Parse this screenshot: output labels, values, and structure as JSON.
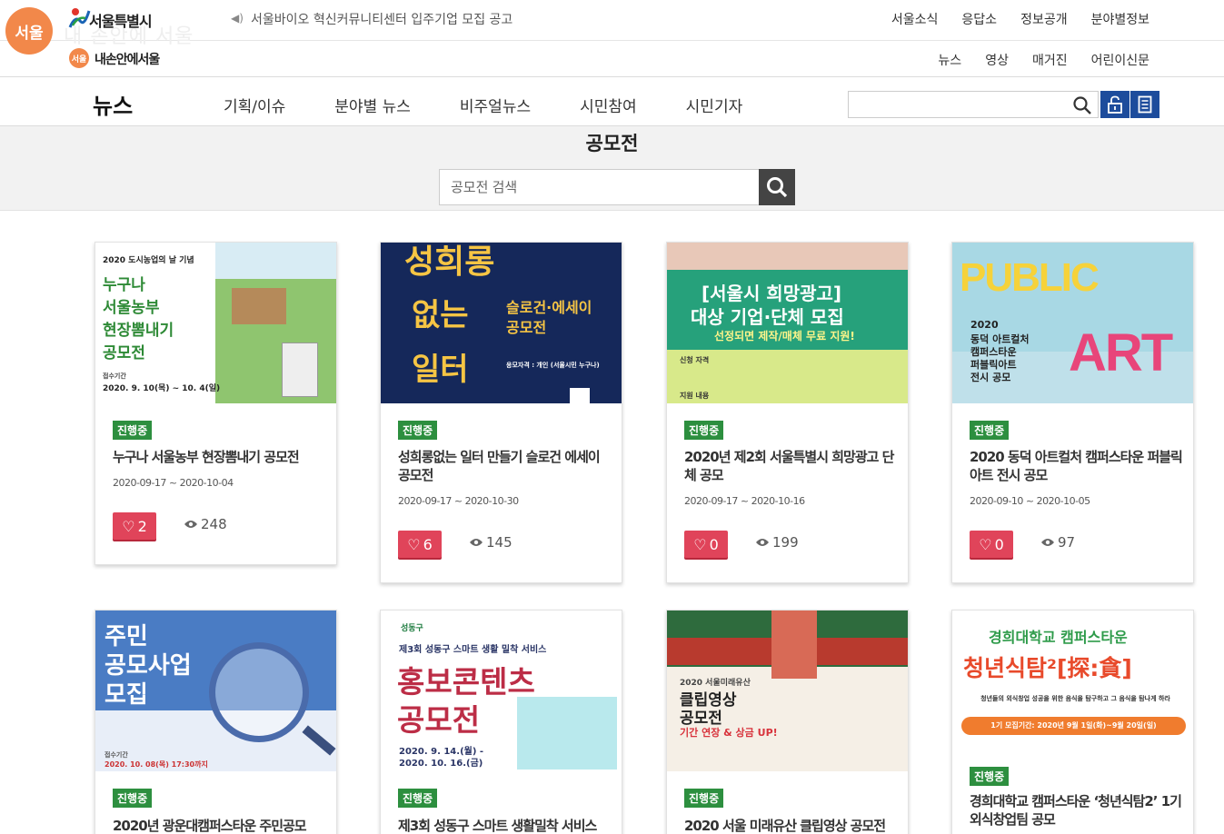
{
  "header": {
    "logo_circle_text": "서울",
    "city_name": "서울특별시",
    "logo_ghost": "내 손안에 서울",
    "notice": "서울바이오 혁신커뮤니티센터 입주기업 모집 공고",
    "util_nav": [
      "서울소식",
      "응답소",
      "정보공개",
      "분야별정보"
    ],
    "sub_logo_mark": "서울",
    "sub_logo": "내손안에서울",
    "sub_nav": [
      "뉴스",
      "영상",
      "매거진",
      "어린이신문"
    ]
  },
  "main_nav": {
    "title": "뉴스",
    "items": [
      "기획/이슈",
      "분야별 뉴스",
      "비주얼뉴스",
      "시민참여",
      "시민기자"
    ],
    "search_placeholder": ""
  },
  "contest": {
    "title": "공모전",
    "search_placeholder": "공모전 검색"
  },
  "cards": [
    {
      "badge": "진행중",
      "title": "누구나 서울농부 현장뽐내기 공모전",
      "date": "2020-09-17 ~ 2020-10-04",
      "likes": "2",
      "views": "248",
      "thumb": {
        "line1": "2020 도시농업의 날 기념",
        "line2": "누구나",
        "line3": "서울농부",
        "line4": "현장뽐내기",
        "line5": "공모전",
        "line6": "접수기간",
        "line7": "2020. 9. 10(목) ~ 10. 4(일)"
      }
    },
    {
      "badge": "진행중",
      "title": "성희롱없는 일터 만들기 슬로건 에세이 공모전",
      "date": "2020-09-17 ~ 2020-10-30",
      "likes": "6",
      "views": "145",
      "thumb": {
        "line1": "성희롱",
        "line2": "없는",
        "line3": "일터",
        "line4": "슬로건·에세이",
        "line5": "공모전",
        "line6": "응모자격 : 개인 (서울시민 누구나)"
      }
    },
    {
      "badge": "진행중",
      "title": "2020년 제2회 서울특별시 희망광고 단체 공모",
      "date": "2020-09-17 ~ 2020-10-16",
      "likes": "0",
      "views": "199",
      "thumb": {
        "line1": "[서울시 희망광고]",
        "line2": "대상 기업·단체 모집",
        "line3": "선정되면 제작/매체 무료 지원!",
        "line4": "신청 자격",
        "line5": "지원 내용"
      }
    },
    {
      "badge": "진행중",
      "title": "2020 동덕 아트컬처 캠퍼스타운 퍼블릭아트 전시 공모",
      "date": "2020-09-10 ~ 2020-10-05",
      "likes": "0",
      "views": "97",
      "thumb": {
        "line1": "PUBLIC",
        "line2": "ART",
        "line3": "2020",
        "line4": "동덕 아트컬처",
        "line5": "캠퍼스타운",
        "line6": "퍼블릭아트",
        "line7": "전시 공모"
      }
    },
    {
      "badge": "진행중",
      "title": "2020년 광운대캠퍼스타운 주민공모",
      "thumb": {
        "line1": "주민",
        "line2": "공모사업",
        "line3": "모집",
        "line4": "접수기간",
        "line5": "2020. 10. 08(목) 17:30까지"
      }
    },
    {
      "badge": "진행중",
      "title": "제3회 성동구 스마트 생활밀착 서비스",
      "thumb": {
        "line1": "성동구",
        "line2": "제3회 성동구 스마트 생활 밀착 서비스",
        "line3": "홍보콘텐츠",
        "line4": "공모전",
        "line5": "2020. 9. 14.(월) -",
        "line6": "2020. 10. 16.(금)"
      }
    },
    {
      "badge": "진행중",
      "title": "2020 서울 미래유산 클립영상 공모전",
      "thumb": {
        "line1": "2020 서울미래유산",
        "line2": "클립영상",
        "line3": "공모전",
        "line4": "기간 연장 & 상금 UP!"
      }
    },
    {
      "badge": "진행중",
      "title": "경희대학교 캠퍼스타운 ‘청년식탐2’ 1기 외식창업팀 공모",
      "thumb": {
        "line1": "경희대학교 캠퍼스타운",
        "line2": "청년식탐²[探:貪]",
        "line3": "청년들의 외식창업 성공을 위한 음식을 탐구하고 그 음식을 탐나게 하라",
        "line4": "1기 모집기간: 2020년 9월 1일(화)~9월 20일(일)"
      }
    }
  ],
  "colors": {
    "brand_blue": "#1d4c9c",
    "badge_green": "#2d8f3f",
    "like_red": "#e0445a",
    "seoul_orange": "#f2884a"
  }
}
